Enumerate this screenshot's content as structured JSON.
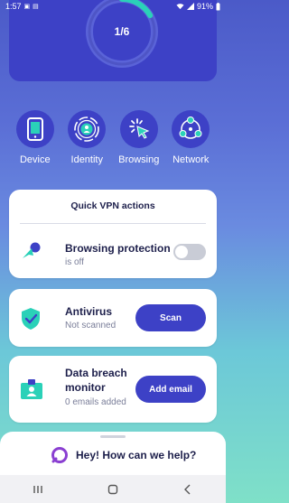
{
  "status_bar": {
    "time": "1:57",
    "battery": "91%"
  },
  "header": {
    "progress_label": "1/6",
    "progress_fraction": 0.1667
  },
  "features": [
    {
      "label": "Device",
      "icon": "phone-icon"
    },
    {
      "label": "Identity",
      "icon": "identity-icon"
    },
    {
      "label": "Browsing",
      "icon": "browsing-cursor-icon"
    },
    {
      "label": "Network",
      "icon": "network-icon"
    }
  ],
  "vpn_card": {
    "title": "Quick VPN actions",
    "browsing_protection": {
      "title": "Browsing protection",
      "status": "is off",
      "toggle_on": false
    }
  },
  "antivirus_card": {
    "title": "Antivirus",
    "status": "Not scanned",
    "button_label": "Scan"
  },
  "breach_card": {
    "title_line1": "Data breach",
    "title_line2": "monitor",
    "status": "0 emails added",
    "button_label": "Add email"
  },
  "help": {
    "label": "Hey! How can we help?"
  },
  "colors": {
    "primary": "#3d41c6",
    "accent_teal": "#2ad1b8",
    "text_dark": "#1d1f4b"
  }
}
